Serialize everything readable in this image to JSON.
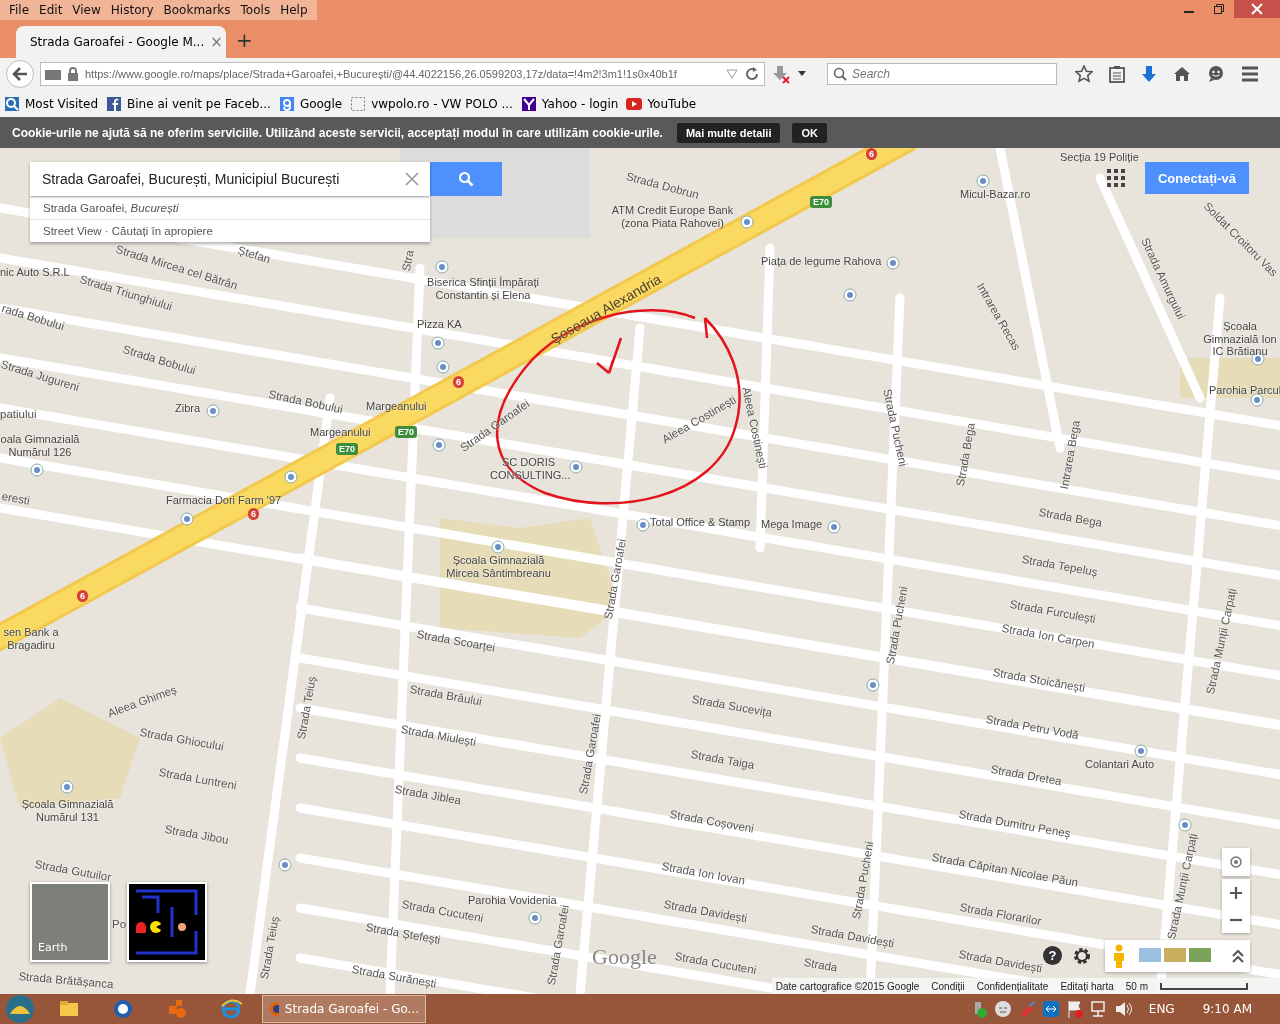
{
  "menu": [
    {
      "label": "File"
    },
    {
      "label": "Edit"
    },
    {
      "label": "View"
    },
    {
      "label": "History"
    },
    {
      "label": "Bookmarks"
    },
    {
      "label": "Tools"
    },
    {
      "label": "Help"
    }
  ],
  "tabs": [
    {
      "title": "Strada Garoafei - Google M...",
      "selected": true,
      "close": "×"
    }
  ],
  "new_tab": "+",
  "address_bar": {
    "url": "https://www.google.ro/maps/place/Strada+Garoafei,+București/@44.4022156,26.0599203,17z/data=!4m2!3m1!1s0x40b1f"
  },
  "search": {
    "placeholder": "Search"
  },
  "bookmarks": [
    {
      "label": "Most Visited"
    },
    {
      "label": "Bine ai venit pe Faceb..."
    },
    {
      "label": "Google"
    },
    {
      "label": "vwpolo.ro - VW POLO ..."
    },
    {
      "label": "Yahoo - login"
    },
    {
      "label": "YouTube"
    }
  ],
  "cookie_bar": {
    "text": "Cookie-urile ne ajută să ne oferim serviciile. Utilizând aceste servicii, acceptați modul în care utilizăm cookie-urile.",
    "buttons": [
      "Mai multe detalii",
      "OK"
    ]
  },
  "map_search": {
    "value": "Strada Garoafei, București, Municipiul București",
    "suggestions": [
      {
        "text": "Strada Garoafei, *București*"
      },
      {
        "text": "Street View · Căutați în apropiere"
      }
    ]
  },
  "sign_in": "Conectați-vă",
  "labels": [
    {
      "text": "Strada Dobrun",
      "kind": "street"
    },
    {
      "text": "ATM Credit Europe Bank (zona Piata Rahovei)",
      "kind": "poi"
    },
    {
      "text": "Micul-Bazar.ro",
      "kind": "poi"
    },
    {
      "text": "Secția 19 Poliție",
      "kind": "poi"
    },
    {
      "text": "Soldat Croitoru Vas",
      "kind": "street"
    },
    {
      "text": "Strada Amurgului",
      "kind": "street"
    },
    {
      "text": "Intrarea Recas",
      "kind": "street"
    },
    {
      "text": "Piața de legume Rahova",
      "kind": "poi"
    },
    {
      "text": "Biserica Sfinții Împărați Constantin și Elena",
      "kind": "poi"
    },
    {
      "text": "Strada Mircea cel Bătrân",
      "kind": "street"
    },
    {
      "text": "Ștefan",
      "kind": "street"
    },
    {
      "text": "nic Auto S.R.L",
      "kind": "poi"
    },
    {
      "text": "Strada Triunghiului",
      "kind": "street"
    },
    {
      "text": "rada Bobului",
      "kind": "street"
    },
    {
      "text": "Strada Bobului",
      "kind": "street"
    },
    {
      "text": "Strada Jugureni",
      "kind": "street"
    },
    {
      "text": "Strada Bobului",
      "kind": "street"
    },
    {
      "text": "Pizza KA",
      "kind": "poi"
    },
    {
      "text": "Șoseaua Alexandria",
      "kind": "highway"
    },
    {
      "text": "Zibra",
      "kind": "poi"
    },
    {
      "text": "Margeanului",
      "kind": "poi"
    },
    {
      "text": "Margeanului",
      "kind": "poi"
    },
    {
      "text": "patiului",
      "kind": "street"
    },
    {
      "text": "oala Gimnazială Numărul 126",
      "kind": "poi"
    },
    {
      "text": "eresti",
      "kind": "street"
    },
    {
      "text": "Farmacia Dori Farm '97",
      "kind": "poi"
    },
    {
      "text": "Strada Garoafei",
      "kind": "street"
    },
    {
      "text": "SC DORIS CONSULTING...",
      "kind": "poi"
    },
    {
      "text": "Aleea Costinești",
      "kind": "street"
    },
    {
      "text": "Aleea Costinești",
      "kind": "street"
    },
    {
      "text": "Strada Pucheni",
      "kind": "street"
    },
    {
      "text": "Strada Bega",
      "kind": "street"
    },
    {
      "text": "Intrarea Bega",
      "kind": "street"
    },
    {
      "text": "Școala Gimnazială Ion IC Brătianu",
      "kind": "poi"
    },
    {
      "text": "Parohia Parcul",
      "kind": "poi"
    },
    {
      "text": "Total Office & Stamp",
      "kind": "poi"
    },
    {
      "text": "Mega Image",
      "kind": "poi"
    },
    {
      "text": "Școala Gimnazială Mircea Sântimbreanu",
      "kind": "poi"
    },
    {
      "text": "Strada Garoafei",
      "kind": "street"
    },
    {
      "text": "Strada Bega",
      "kind": "street"
    },
    {
      "text": "Strada Tepeluș",
      "kind": "street"
    },
    {
      "text": "Strada Furculești",
      "kind": "street"
    },
    {
      "text": "Strada Ion Carpen",
      "kind": "street"
    },
    {
      "text": "Strada Stoicănești",
      "kind": "street"
    },
    {
      "text": "Strada Petru Vodă",
      "kind": "street"
    },
    {
      "text": "Colantari Auto",
      "kind": "poi"
    },
    {
      "text": "Strada Dretea",
      "kind": "street"
    },
    {
      "text": "Strada Dumitru Peneș",
      "kind": "street"
    },
    {
      "text": "Strada Căpitan Nicolae Păun",
      "kind": "street"
    },
    {
      "text": "Strada Florarilor",
      "kind": "street"
    },
    {
      "text": "Strada Davidești",
      "kind": "street"
    },
    {
      "text": "Strada Davidești",
      "kind": "street"
    },
    {
      "text": "Strada Davidești",
      "kind": "street"
    },
    {
      "text": "Strada Munții Carpați",
      "kind": "street"
    },
    {
      "text": "Strada Munții Carpați",
      "kind": "street"
    },
    {
      "text": "Strada Pucheni",
      "kind": "street"
    },
    {
      "text": "Strada Pucheni",
      "kind": "street"
    },
    {
      "text": "sen Bank a Bragadiru",
      "kind": "poi"
    },
    {
      "text": "Strada Scoarței",
      "kind": "street"
    },
    {
      "text": "Aleea Ghimeș",
      "kind": "street"
    },
    {
      "text": "Strada Teiuș",
      "kind": "street"
    },
    {
      "text": "Strada Teiuș",
      "kind": "street"
    },
    {
      "text": "Strada Brâului",
      "kind": "street"
    },
    {
      "text": "Strada Miulești",
      "kind": "street"
    },
    {
      "text": "Strada Sucevița",
      "kind": "street"
    },
    {
      "text": "Strada Ghiocului",
      "kind": "street"
    },
    {
      "text": "Strada Garoafei",
      "kind": "street"
    },
    {
      "text": "Strada Taiga",
      "kind": "street"
    },
    {
      "text": "Strada Luntreni",
      "kind": "street"
    },
    {
      "text": "Strada Jiblea",
      "kind": "street"
    },
    {
      "text": "Școala Gimnazială Numărul 131",
      "kind": "poi"
    },
    {
      "text": "Strada Coșoveni",
      "kind": "street"
    },
    {
      "text": "Strada Jibou",
      "kind": "street"
    },
    {
      "text": "Strada Gutuilor",
      "kind": "street"
    },
    {
      "text": "Strada Ion Iovan",
      "kind": "street"
    },
    {
      "text": "Parohia Vovidenia",
      "kind": "poi"
    },
    {
      "text": "Strada Cucuteni",
      "kind": "street"
    },
    {
      "text": "Strada Ștefești",
      "kind": "street"
    },
    {
      "text": "Strada Cucuteni",
      "kind": "street"
    },
    {
      "text": "Strada Brătășanca",
      "kind": "street"
    },
    {
      "text": "Strada Surănești",
      "kind": "street"
    },
    {
      "text": "Strada Garoafei",
      "kind": "street"
    },
    {
      "text": "Po",
      "kind": "street"
    },
    {
      "text": "Strada",
      "kind": "street"
    },
    {
      "text": "Stra",
      "kind": "street"
    }
  ],
  "shields": [
    {
      "text": "6",
      "kind": "national"
    },
    {
      "text": "6",
      "kind": "national"
    },
    {
      "text": "6",
      "kind": "national"
    },
    {
      "text": "6",
      "kind": "national"
    },
    {
      "text": "E70",
      "kind": "european"
    },
    {
      "text": "E70",
      "kind": "european"
    },
    {
      "text": "E70",
      "kind": "european"
    }
  ],
  "layers": [
    {
      "label": "Earth",
      "kind": "satellite"
    },
    {
      "kind": "game"
    }
  ],
  "logo": "Google",
  "help": "?",
  "footer": {
    "items": [
      "Date cartografice ©2015 Google",
      "Condiții",
      "Confidențialitate",
      "Editați harta"
    ],
    "scale": "50 m"
  },
  "taskbar": {
    "window": "Strada Garoafei - Go...",
    "language": "ENG",
    "time": "9:10 AM"
  }
}
